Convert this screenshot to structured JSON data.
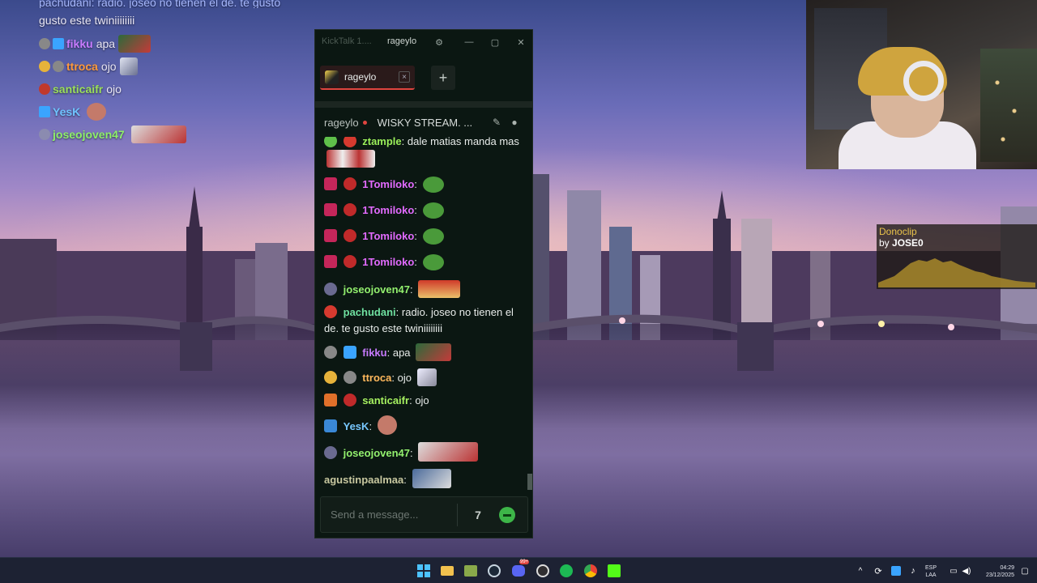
{
  "overlay_chat": {
    "top_partial": "pachudani: radio. joseo no tienen el de. te gusto este twiniiiiiiii",
    "top_partial_line2": "gusto este twiniiiiiiii",
    "lines": [
      {
        "user": "fikku",
        "user_color": "#c87bff",
        "text": "apa"
      },
      {
        "user": "ttroca",
        "user_color": "#ff9a3d",
        "text": "ojo"
      },
      {
        "user": "santicaifr",
        "user_color": "#9be05a",
        "text": "ojo"
      },
      {
        "user": "YesK",
        "user_color": "#6fc3ff",
        "text": ""
      },
      {
        "user": "joseojoven47",
        "user_color": "#8ef06a",
        "text": ""
      }
    ]
  },
  "donoclip": {
    "title": "Donoclip",
    "by_prefix": "by",
    "by_user": "JOSE0"
  },
  "window": {
    "app_name": "KickTalk 1....",
    "title": "rageylo",
    "settings_icon": "gear-icon",
    "minimize_icon": "minimize-icon",
    "maximize_icon": "maximize-icon",
    "close_icon": "close-icon"
  },
  "tabs": [
    {
      "label": "rageylo",
      "close": "×"
    }
  ],
  "add_tab_label": "+",
  "channel": {
    "name": "rageylo",
    "stream_title": "WISKY STREAM. ..."
  },
  "messages": [
    {
      "user": "ztample",
      "user_color": "#9bef5a",
      "sep": ":",
      "text": "dale matias manda mas"
    },
    {
      "user": "1Tomiloko",
      "user_color": "#e36bff",
      "sep": ":",
      "text": ""
    },
    {
      "user": "1Tomiloko",
      "user_color": "#e36bff",
      "sep": ":",
      "text": ""
    },
    {
      "user": "1Tomiloko",
      "user_color": "#e36bff",
      "sep": ":",
      "text": ""
    },
    {
      "user": "1Tomiloko",
      "user_color": "#e36bff",
      "sep": ":",
      "text": ""
    },
    {
      "user": "joseojoven47",
      "user_color": "#93f06e",
      "sep": ":",
      "text": ""
    },
    {
      "user": "pachudani",
      "user_color": "#6fe0a0",
      "sep": ":",
      "text": "radio. joseo no tienen el de. te gusto este twiniiiiiiii"
    },
    {
      "user": "fikku",
      "user_color": "#c87bff",
      "sep": ":",
      "text": "apa"
    },
    {
      "user": "ttroca",
      "user_color": "#ffb85c",
      "sep": ":",
      "text": "ojo"
    },
    {
      "user": "santicaifr",
      "user_color": "#a6f060",
      "sep": ":",
      "text": "ojo"
    },
    {
      "user": "YesK",
      "user_color": "#78c8ff",
      "sep": ":",
      "text": ""
    },
    {
      "user": "joseojoven47",
      "user_color": "#93f06e",
      "sep": ":",
      "text": ""
    },
    {
      "user": "agustinpaalmaa",
      "user_color": "#c8c8a0",
      "sep": ":",
      "text": ""
    }
  ],
  "composer": {
    "placeholder": "Send a message..."
  },
  "taskbar": {
    "lang_top": "ESP",
    "lang_bottom": "LAA",
    "time": "04:29",
    "date": "23/12/2025",
    "badge_count": "99+"
  },
  "colors": {
    "accent_green": "#3db548",
    "live_red": "#e0453f",
    "window_bg": "#0b1712"
  }
}
